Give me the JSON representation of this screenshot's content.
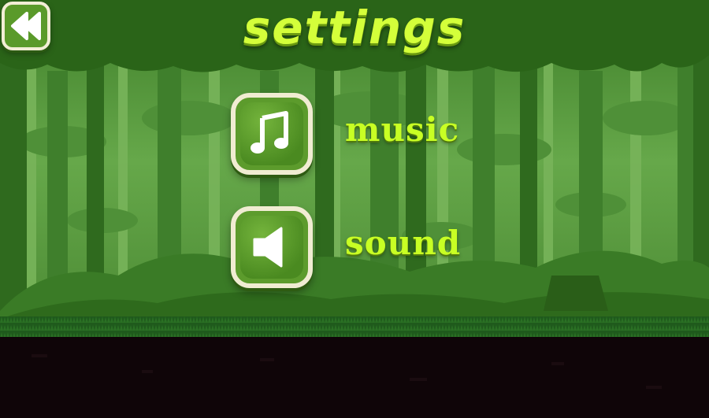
{
  "header": {
    "title": "settings"
  },
  "back_button": {
    "icon": "rewind-icon"
  },
  "options": [
    {
      "icon": "music-note-icon",
      "label": "music"
    },
    {
      "icon": "speaker-icon",
      "label": "sound"
    }
  ],
  "colors": {
    "title": "#d4ff3a",
    "label": "#c8ff24",
    "button_fill": "#5c9b2c",
    "button_border": "#f0ecd2",
    "forest_back": "#5a9a3e",
    "forest_front": "#2e6a1c",
    "ground": "#0f0508"
  }
}
